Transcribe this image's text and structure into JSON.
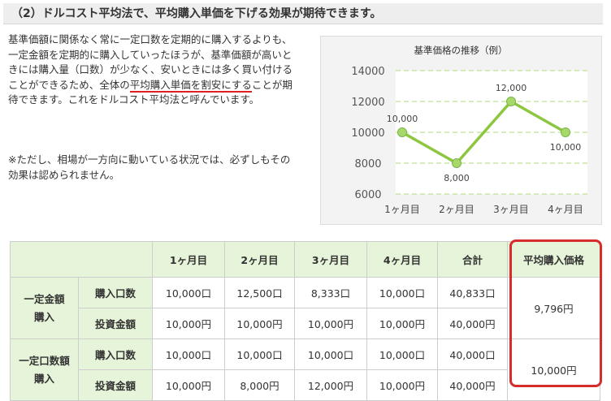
{
  "heading": "（2）ドルコスト平均法で、平均購入単価を下げる効果が期待できます。",
  "paragraph1": {
    "pre": "基準価額に関係なく常に一定口数を定期的に購入するよりも、一定金額を定期的に購入していったほうが、基準価額が高いときには購入量（口数）が少なく、安いときには多く買い付けることができるため、全体の",
    "highlight": "平均購入単価を割安にする",
    "post": "ことが期待できます。これをドルコスト平均法と呼んでいます。"
  },
  "paragraph2": "※ただし、相場が一方向に動いている状況では、必ずしもその効果は認められません。",
  "chart_data": {
    "type": "line",
    "title": "基準価格の推移（例）",
    "categories": [
      "1ヶ月目",
      "2ヶ月目",
      "3ヶ月目",
      "4ヶ月目"
    ],
    "series": [
      {
        "values": [
          10000,
          8000,
          12000,
          10000
        ]
      }
    ],
    "point_labels": [
      "10,000",
      "8,000",
      "12,000",
      "10,000"
    ],
    "ylim": [
      6000,
      14000
    ],
    "yticks": [
      6000,
      8000,
      10000,
      12000,
      14000
    ],
    "grid": true,
    "line_color": "#8dc63f",
    "marker_color": "#a8d86a",
    "grid_color": "#c8e6a6"
  },
  "table": {
    "headers": [
      "1ヶ月目",
      "2ヶ月目",
      "3ヶ月目",
      "4ヶ月目",
      "合計",
      "平均購入価格"
    ],
    "groups": [
      {
        "label_line1": "一定金額",
        "label_line2": "購入",
        "rows": [
          {
            "label": "購入口数",
            "cells": [
              "10,000口",
              "12,500口",
              "8,333口",
              "10,000口",
              "40,833口"
            ]
          },
          {
            "label": "投資金額",
            "cells": [
              "10,000円",
              "10,000円",
              "10,000円",
              "10,000円",
              "40,000円"
            ]
          }
        ],
        "average": "9,796円"
      },
      {
        "label_line1": "一定口数額",
        "label_line2": "購入",
        "rows": [
          {
            "label": "購入口数",
            "cells": [
              "10,000口",
              "10,000口",
              "10,000口",
              "10,000口",
              "40,000口"
            ]
          },
          {
            "label": "投資金額",
            "cells": [
              "10,000円",
              "8,000円",
              "12,000円",
              "10,000円",
              "40,000円"
            ]
          }
        ],
        "average": "10,000円"
      }
    ],
    "highlight_color": "#d62c2c",
    "header_bg": "#e6f4d9"
  }
}
